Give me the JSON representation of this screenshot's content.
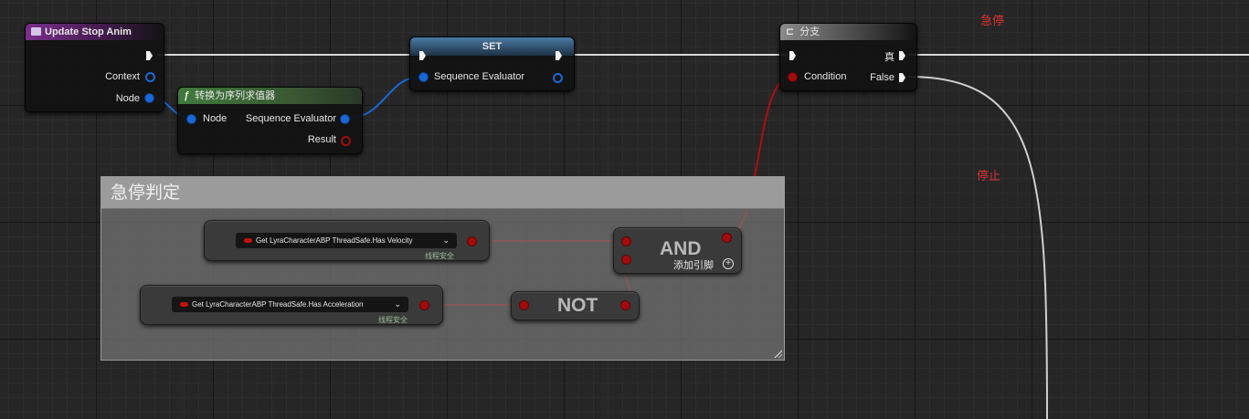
{
  "comment": {
    "title": "急停判定"
  },
  "nodes": {
    "update": {
      "title": "Update Stop Anim",
      "context_label": "Context",
      "node_label": "Node"
    },
    "convert": {
      "title": "转换为序列求值器",
      "node_label": "Node",
      "out_label": "Sequence Evaluator",
      "result_label": "Result"
    },
    "set": {
      "title": "SET",
      "pin_label": "Sequence Evaluator"
    },
    "branch": {
      "title": "分支",
      "condition_label": "Condition",
      "true_label": "真",
      "false_label": "False"
    },
    "velocity": {
      "label": "Get LyraCharacterABP ThreadSafe.Has Velocity",
      "tag": "线程安全"
    },
    "accel": {
      "label": "Get LyraCharacterABP ThreadSafe.Has Acceleration",
      "tag": "线程安全"
    },
    "and": {
      "title": "AND",
      "add_pin": "添加引脚"
    },
    "not": {
      "title": "NOT"
    }
  },
  "annotations": {
    "stop_fast": "急停",
    "stop": "停止"
  },
  "colors": {
    "exec": "#f2f2f2",
    "struct_pin": "#1a68d6",
    "bool_pin": "#a30c0c",
    "purple_header": "#7a2f8b",
    "green_header": "#3f7a3c",
    "red_text": "#e03030"
  }
}
